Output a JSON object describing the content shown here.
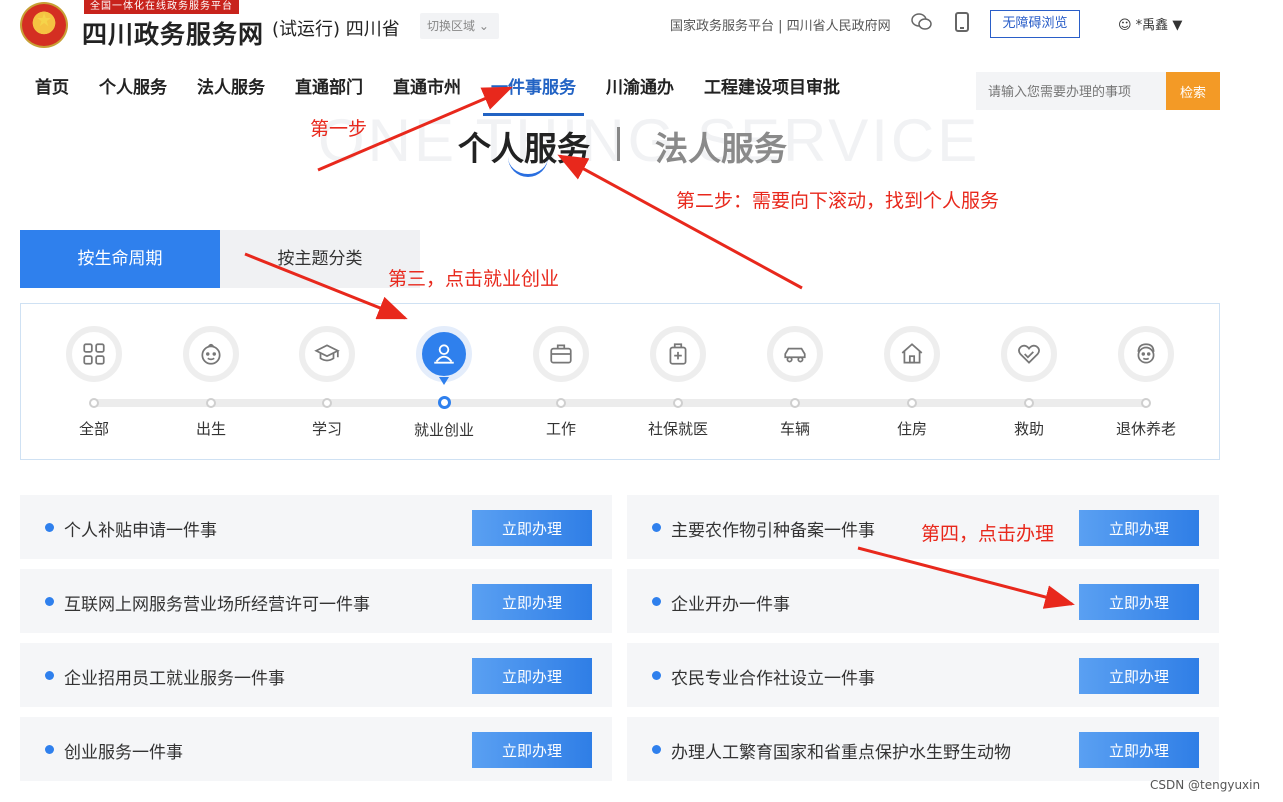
{
  "header": {
    "tag": "全国一体化在线政务服务平台",
    "title": "四川政务服务网",
    "subtitle": "(试运行) 四川省",
    "region_switch": "切换区域 ⌄",
    "top_links": "国家政务服务平台 | 四川省人民政府网",
    "accessible": "无障碍浏览",
    "user": "☺ *禹鑫 ▼"
  },
  "nav": {
    "items": [
      "首页",
      "个人服务",
      "法人服务",
      "直通部门",
      "直通市州",
      "一件事服务",
      "川渝通办",
      "工程建设项目审批"
    ],
    "search_placeholder": "请输入您需要办理的事项",
    "search_button": "检索"
  },
  "section": {
    "bg_text": "ONE THING SERVICE",
    "personal": "个人服务",
    "legal": "法人服务"
  },
  "tabs": {
    "life": "按生命周期",
    "topic": "按主题分类"
  },
  "cycle": [
    "全部",
    "出生",
    "学习",
    "就业创业",
    "工作",
    "社保就医",
    "车辆",
    "住房",
    "救助",
    "退休养老"
  ],
  "cards": [
    {
      "title": "个人补贴申请一件事",
      "button": "立即办理"
    },
    {
      "title": "主要农作物引种备案一件事",
      "button": "立即办理"
    },
    {
      "title": "互联网上网服务营业场所经营许可一件事",
      "button": "立即办理"
    },
    {
      "title": "企业开办一件事",
      "button": "立即办理"
    },
    {
      "title": "企业招用员工就业服务一件事",
      "button": "立即办理"
    },
    {
      "title": "农民专业合作社设立一件事",
      "button": "立即办理"
    },
    {
      "title": "创业服务一件事",
      "button": "立即办理"
    },
    {
      "title": "办理人工繁育国家和省重点保护水生野生动物",
      "button": "立即办理"
    }
  ],
  "annotations": {
    "step1": "第一步",
    "step2": "第二步：需要向下滚动，找到个人服务",
    "step3": "第三，点击就业创业",
    "step4": "第四，点击办理"
  },
  "watermark": "CSDN @tengyuxin",
  "colors": {
    "accent": "#2f80ed",
    "nav_active": "#2263c4",
    "search_btn": "#f39a26",
    "annotation": "#e8281c"
  }
}
